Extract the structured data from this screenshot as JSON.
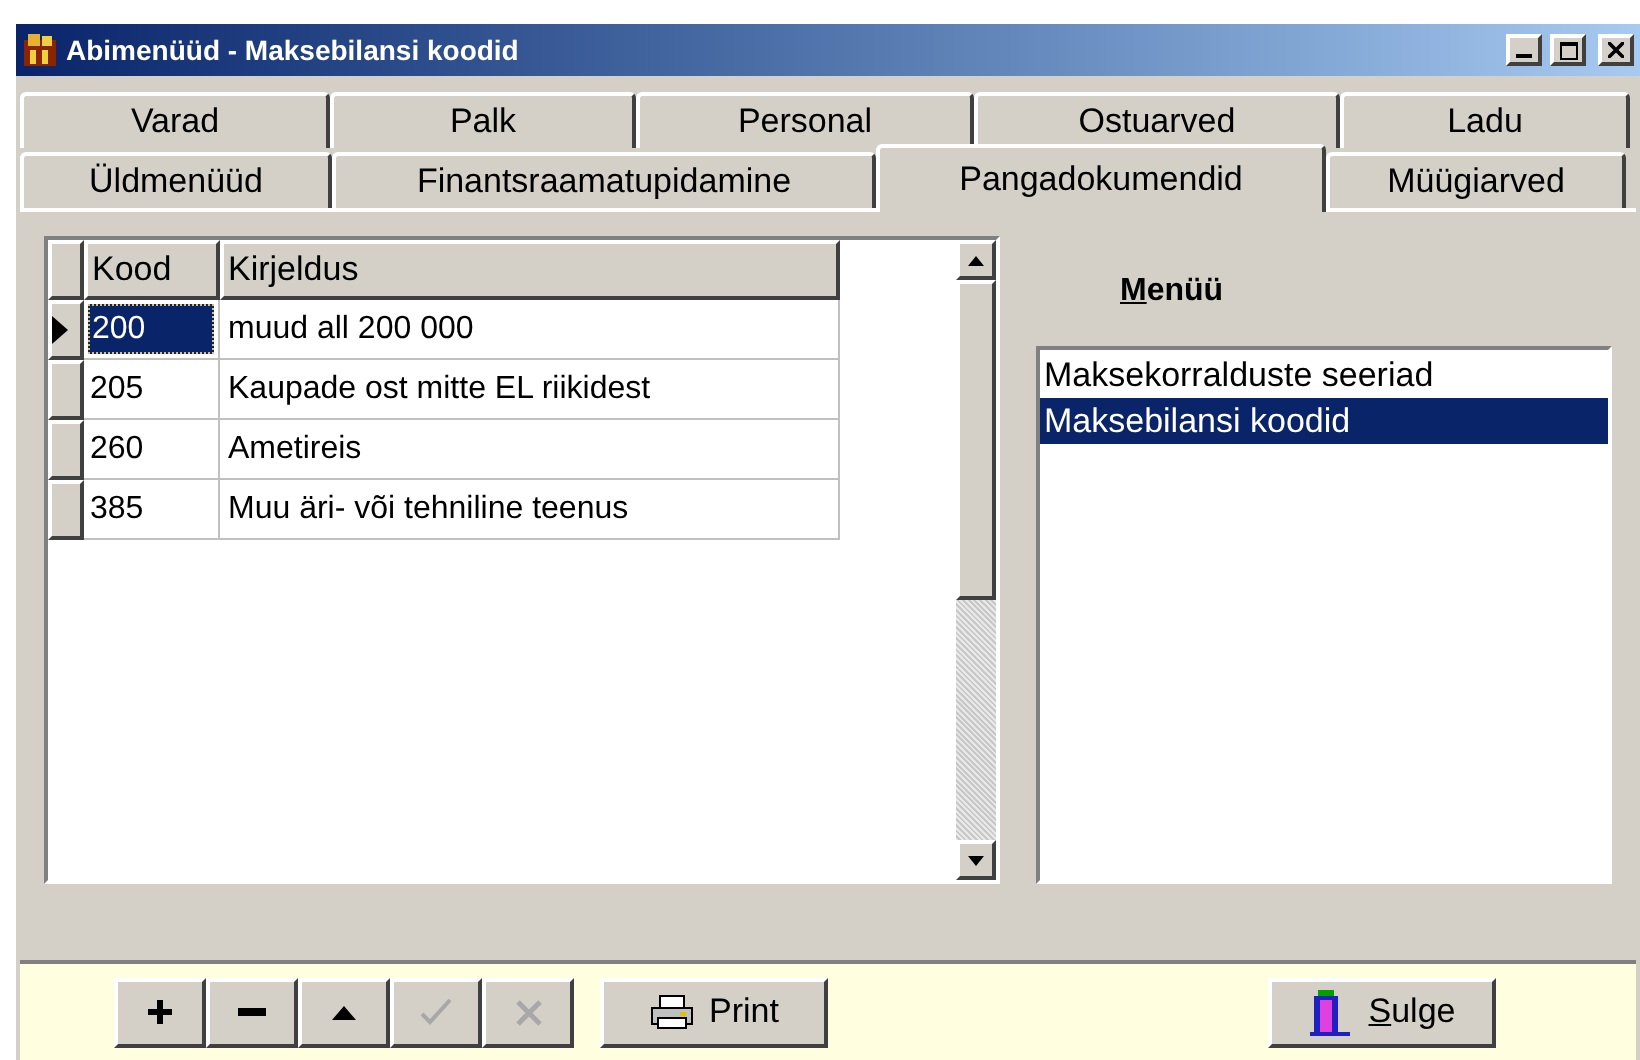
{
  "window": {
    "title": "Abimenüüd - Maksebilansi koodid"
  },
  "tab_rows": [
    [
      {
        "label": "Varad",
        "selected": false
      },
      {
        "label": "Palk",
        "selected": false
      },
      {
        "label": "Personal",
        "selected": false
      },
      {
        "label": "Ostuarved",
        "selected": false
      },
      {
        "label": "Ladu",
        "selected": false
      }
    ],
    [
      {
        "label": "Üldmenüüd",
        "selected": false
      },
      {
        "label": "Finantsraamatupidamine",
        "selected": false
      },
      {
        "label": "Pangadokumendid",
        "selected": true
      },
      {
        "label": "Müügiarved",
        "selected": false
      }
    ]
  ],
  "table": {
    "columns": [
      "Kood",
      "Kirjeldus"
    ],
    "rows": [
      {
        "code": "200",
        "description": "muud all 200 000",
        "selected": true
      },
      {
        "code": "205",
        "description": "Kaupade ost mitte EL riikidest",
        "selected": false
      },
      {
        "code": "260",
        "description": "Ametireis",
        "selected": false
      },
      {
        "code": "385",
        "description": "Muu äri- või tehniline teenus",
        "selected": false
      }
    ]
  },
  "menu": {
    "label": "Menüü",
    "items": [
      {
        "label": "Maksekorralduste seeriad",
        "selected": false
      },
      {
        "label": "Maksebilansi koodid",
        "selected": true
      }
    ]
  },
  "toolbar": [
    {
      "kind": "add",
      "disabled": false
    },
    {
      "kind": "remove",
      "disabled": false
    },
    {
      "kind": "up",
      "disabled": false
    },
    {
      "kind": "confirm",
      "disabled": true
    },
    {
      "kind": "cancel",
      "disabled": true
    }
  ],
  "print_button": {
    "label": "Print"
  },
  "close_button": {
    "label": "Sulge"
  }
}
